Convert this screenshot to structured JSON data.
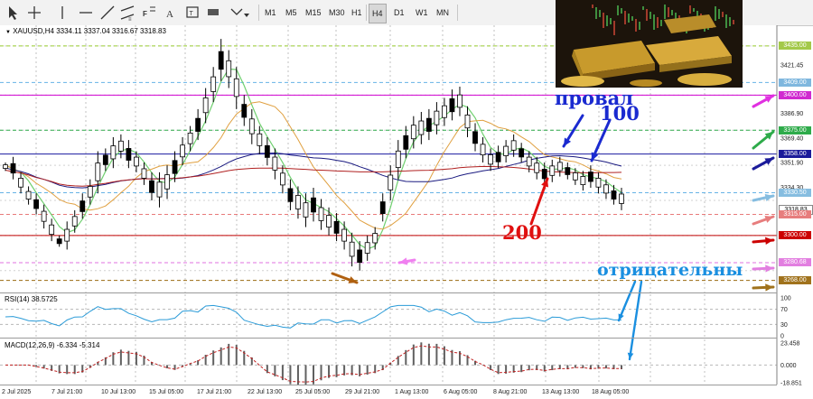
{
  "toolbar": {
    "timeframes": [
      "M1",
      "M5",
      "M15",
      "M30",
      "H1",
      "H4",
      "D1",
      "W1",
      "MN"
    ]
  },
  "chart": {
    "symbol_line": "XAUUSD,H4  3334.11 3337.04 3316.67 3318.83",
    "price_ticks": [
      "3435.00",
      "3421.45",
      "3409.00",
      "3400.00",
      "3386.90",
      "3375.00",
      "3369.40",
      "3358.00",
      "3351.90",
      "3334.30",
      "3330.50",
      "3318.83",
      "3315.00",
      "3300.00",
      "3280.68",
      "3268.00"
    ],
    "time_labels": [
      "2 Jul 2025",
      "7 Jul 21:00",
      "10 Jul 13:00",
      "15 Jul 05:00",
      "17 Jul 21:00",
      "22 Jul 13:00",
      "25 Jul 05:00",
      "29 Jul 21:00",
      "1 Aug 13:00",
      "6 Aug 05:00",
      "8 Aug 21:00",
      "13 Aug 13:00",
      "18 Aug 05:00"
    ],
    "price_range": [
      3262,
      3442
    ],
    "levels": [
      {
        "price": 3435.0,
        "color": "#9acd32",
        "style": "dash"
      },
      {
        "price": 3409.0,
        "color": "#66b3e6",
        "style": "dash"
      },
      {
        "price": 3400.0,
        "color": "#d000d0",
        "style": "solid"
      },
      {
        "price": 3375.0,
        "color": "#2eab4a",
        "style": "dash"
      },
      {
        "price": 3358.0,
        "color": "#1a1aa0",
        "style": "solid"
      },
      {
        "price": 3330.5,
        "color": "#66b3e6",
        "style": "dash"
      },
      {
        "price": 3315.0,
        "color": "#e87a7a",
        "style": "dash"
      },
      {
        "price": 3300.0,
        "color": "#c00000",
        "style": "solid"
      },
      {
        "price": 3280.68,
        "color": "#e070e0",
        "style": "dash"
      },
      {
        "price": 3268.0,
        "color": "#9a6a10",
        "style": "dash"
      }
    ],
    "tag_colors": {
      "3435.00": "#a3c94a",
      "3409.00": "#7fb7de",
      "3400.00": "#d02ad0",
      "3375.00": "#2eab4a",
      "3358.00": "#1b1b9a",
      "3330.50": "#86bde0",
      "3318.83": "#ffffff",
      "3315.00": "#e77d7d",
      "3300.00": "#cc0000",
      "3280.68": "#e27ee0",
      "3268.00": "#a0721c"
    }
  },
  "rsi": {
    "label": "RSI(14) 38.5725",
    "ticks": [
      "100",
      "70",
      "30",
      "0"
    ],
    "value": 38.5725
  },
  "macd": {
    "label": "MACD(12,26,9) -6.334 -5.314",
    "ticks": [
      "23.458",
      "0.000",
      "-18.851"
    ],
    "macd": -6.334,
    "signal": -5.314
  },
  "annotations": {
    "proval": "провал",
    "hundred": "100",
    "two_hundred": "200",
    "negative": "отрицательны"
  },
  "colors": {
    "ma_fast": "#70d070",
    "ma_mid": "#e0a040",
    "ma_100": "#1a1a80",
    "ma_200": "#b02020",
    "candle": "#000000",
    "annotation_blue": "#1a2ad0",
    "annotation_red": "#e01010",
    "annotation_lightblue": "#1a8fe0"
  }
}
